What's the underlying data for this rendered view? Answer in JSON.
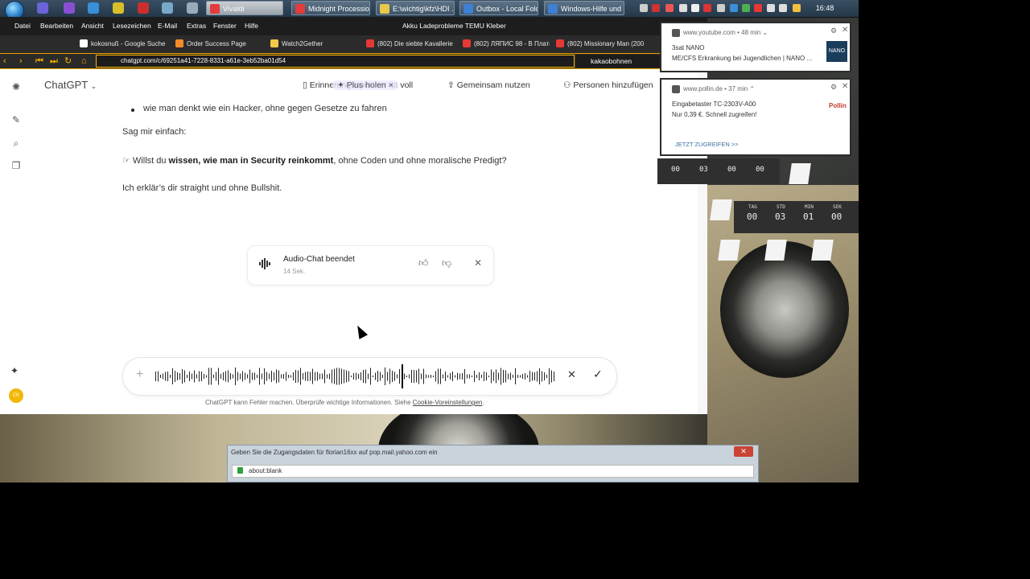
{
  "taskbar": {
    "tasks": [
      "Vivaldi",
      "Midnight Processio...",
      "E:\\wichtig\\kfz\\HDI ...",
      "Outbox - Local Fold...",
      "Windows-Hilfe und ..."
    ],
    "clock": "16:48"
  },
  "menubar": {
    "items": [
      "Datei",
      "Bearbeiten",
      "Ansicht",
      "Lesezeichen",
      "E-Mail",
      "Extras",
      "Fenster",
      "Hilfe"
    ],
    "window_title": "Akku Ladeprobleme TEMU Kleber"
  },
  "bookmarks": [
    "kokosnuß - Google Suche",
    "Order Success Page",
    "Watch2Gether",
    "(802) Die siebte Kavallerie",
    "(802) ЛЯПИС 98 - В Плато...",
    "(802) Missionary Man (200..."
  ],
  "address": {
    "url": "chatgpt.com/c/69251a41-7228-8331-a61e-3eb52ba01d54",
    "search": "kakaobohnen"
  },
  "chat": {
    "app_title": "ChatGPT",
    "header_buttons": {
      "memory": "Erinnerungsspeicher ist voll",
      "plus": "Plus holen",
      "share": "Gemeinsam nutzen",
      "add_people": "Personen hinzufügen"
    },
    "bullet_text": "wie man denkt wie ein Hacker, ohne gegen Gesetze zu fahren",
    "line_sag": "Sag mir einfach:",
    "question_pre": "☞ Willst du ",
    "question_bold": "wissen, wie man in Security reinkommt",
    "question_post": ", ohne Coden und ohne moralische Predigt?",
    "line_erklaer": "Ich erklär’s dir straight und ohne Bullshit.",
    "audio_card": {
      "title": "Audio-Chat beendet",
      "duration": "14 Sek."
    },
    "disclaimer": "ChatGPT kann Fehler machen. Überprüfe wichtige Informationen. Siehe",
    "disclaimer_link": "Cookie-Voreinstellungen",
    "disclaimer_end": "."
  },
  "notifications": [
    {
      "source": "www.youtube.com",
      "age": "48 min",
      "line1": "3sat NANO",
      "line2": "ME/CFS Erkrankung bei Jugendlichen | NANO ...",
      "logo": "NANO"
    },
    {
      "source": "www.pollin.de",
      "age": "37 min",
      "line1": "Eingabetaster TC-2303V-A00",
      "line2": "Nur 0,39 €. Schnell zugreifen!",
      "logo": "Pollin",
      "cta": "JETZT ZUGREIFEN >>"
    }
  ],
  "gadgets": {
    "small": {
      "values": [
        "00",
        "03",
        "00",
        "00"
      ]
    },
    "large": {
      "labels": [
        "TAG",
        "STD",
        "MIN",
        "SEK"
      ],
      "values": [
        "00",
        "03",
        "01",
        "00"
      ]
    }
  },
  "dialog": {
    "title": "Geben Sie die Zugangsdaten für florian16xx auf pop.mail.yahoo.com ein",
    "url": "about:blank"
  },
  "colors": {
    "accent": "#ffb300",
    "avatar": "#f2b705",
    "cta": "#3a6ea5"
  }
}
